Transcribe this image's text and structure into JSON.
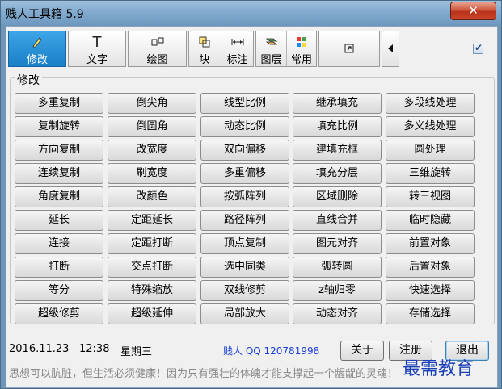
{
  "window": {
    "title": "贱人工具箱 5.9"
  },
  "toolbar": {
    "modify": "修改",
    "text": "文字",
    "draw": "绘图",
    "block": "块",
    "dimension": "标注",
    "layer": "图层",
    "common": "常用"
  },
  "group": {
    "label": "修改",
    "buttons": [
      [
        "多重复制",
        "倒尖角",
        "线型比例",
        "继承填充",
        "多段线处理"
      ],
      [
        "复制旋转",
        "倒圆角",
        "动态比例",
        "填充比例",
        "多义线处理"
      ],
      [
        "方向复制",
        "改宽度",
        "双向偏移",
        "建填充框",
        "圆处理"
      ],
      [
        "连续复制",
        "刷宽度",
        "多重偏移",
        "填充分层",
        "三维旋转"
      ],
      [
        "角度复制",
        "改颜色",
        "按弧阵列",
        "区域删除",
        "转三视图"
      ],
      [
        "延长",
        "定距延长",
        "路径阵列",
        "直线合并",
        "临时隐藏"
      ],
      [
        "连接",
        "定距打断",
        "顶点复制",
        "图元对齐",
        "前置对象"
      ],
      [
        "打断",
        "交点打断",
        "选中同类",
        "弧转圆",
        "后置对象"
      ],
      [
        "等分",
        "特殊缩放",
        "双线修剪",
        "z轴归零",
        "快速选择"
      ],
      [
        "超级修剪",
        "超级延伸",
        "局部放大",
        "动态对齐",
        "存储选择"
      ]
    ]
  },
  "status": {
    "date": "2016.11.23",
    "time": "12:38",
    "weekday": "星期三",
    "contact": "贱人 QQ 120781998"
  },
  "footer_buttons": {
    "about": "关于",
    "register": "注册",
    "exit": "退出"
  },
  "motto": "思想可以肮脏，但生活必须健康！因为只有强壮的体魄才能支撑起一个龌龊的灵魂！",
  "watermark": "最需教育",
  "icons": {
    "modify": "pencil-icon",
    "text": "text-T-icon",
    "draw": "draw-shapes-icon",
    "block": "block-icon",
    "dimension": "dimension-icon",
    "layer": "layers-icon",
    "common": "grid-colored-icon",
    "expand": "expand-icon",
    "scroll_left": "triangle-left-icon",
    "close": "close-icon"
  }
}
